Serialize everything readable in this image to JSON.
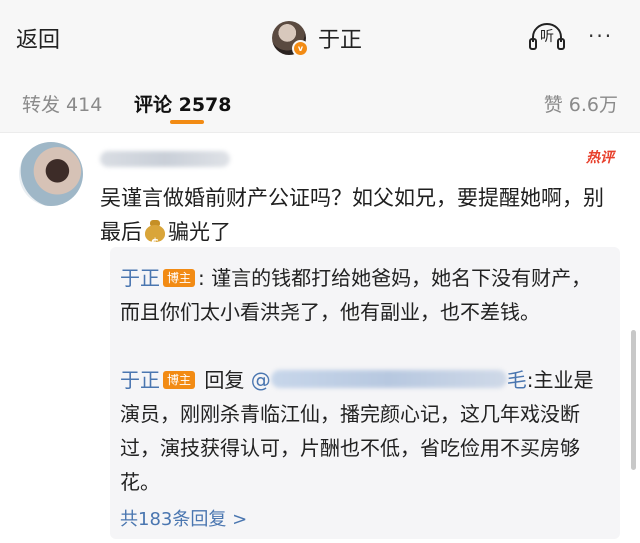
{
  "nav": {
    "back_label": "返回",
    "user_name": "于正",
    "verified_mark": "v",
    "listen_label": "听",
    "more_label": "···"
  },
  "tabs": {
    "forward": "转发 414",
    "comment": "评论 2578",
    "like": "赞 6.6万"
  },
  "comment": {
    "hot_badge": "热评",
    "text_before_icon": "吴谨言做婚前财产公证吗？如父如兄，要提醒她啊，别最后",
    "money_icon_glyph": "$",
    "text_after_icon": "骗光了"
  },
  "replies": [
    {
      "author": "于正",
      "badge": "博主",
      "text": ": 谨言的钱都打给她爸妈，她名下没有财产，而且你们太小看洪尧了，他有副业，也不差钱。"
    },
    {
      "author": "于正",
      "badge": "博主",
      "reply_word": " 回复 ",
      "mention_prefix": "@",
      "mention_suffix": "毛",
      "text": ":主业是演员，刚刚杀青临江仙，播完颜心记，这几年戏没断过，演技获得认可，片酬也不低，省吃俭用不买房够花。"
    }
  ],
  "more_replies": "共183条回复 >",
  "colors": {
    "accent": "#f28b14",
    "link": "#4a76b0",
    "hot": "#e8402c"
  }
}
